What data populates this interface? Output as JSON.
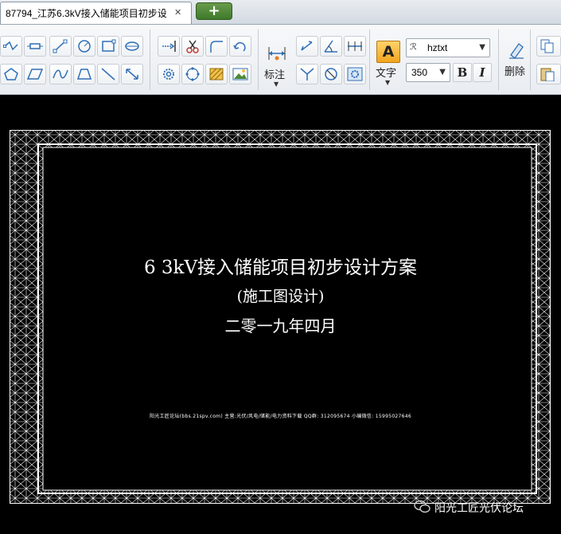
{
  "tab": {
    "title": "87794_江苏6.3kV接入储能项目初步设",
    "close": "✕",
    "new": "+"
  },
  "toolbar": {
    "dimension_label": "标注",
    "text_label": "文字",
    "delete_label": "删除",
    "font_name": "hztxt",
    "font_size": "350",
    "bold": "B",
    "italic": "I",
    "text_icon": "A"
  },
  "icons": {
    "draw_row1": [
      "polyline-icon",
      "rectangle-dim-icon",
      "spline-node-icon",
      "circle-icon",
      "rect-corner-icon",
      "ellipse-icon"
    ],
    "draw_row2": [
      "pentagon-icon",
      "parallelogram-icon",
      "curve-icon",
      "trapezoid-icon",
      "line-icon",
      "double-arrow-icon"
    ],
    "edit_row1": [
      "extend-icon",
      "scissors-icon",
      "fillet-icon",
      "rotate-icon"
    ],
    "edit_row2": [
      "gear-icon",
      "array-icon",
      "hatch-icon",
      "image-icon"
    ]
  },
  "drawing": {
    "title_line1": "6 3kV接入储能项目初步设计方案",
    "title_line2": "(施工图设计)",
    "title_line3": "二零一九年四月",
    "footer": "阳光工匠论坛(bbs.21spv.com)    主营:光伏/风电/储能/电力资料下载    QQ群: 312095674    小编微信: 15995027646"
  },
  "watermark": {
    "text": "阳光工匠光伏论坛"
  },
  "colors": {
    "toolbar_bg": "#eef1f4",
    "canvas_bg": "#000000",
    "new_tab": "#4d8a34",
    "accent_blue": "#2f6fb5"
  }
}
